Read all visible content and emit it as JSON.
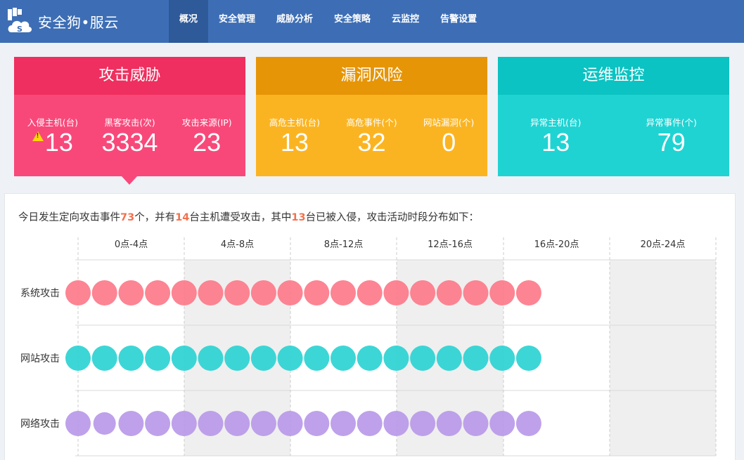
{
  "app": {
    "title": "安全狗•服云"
  },
  "nav": {
    "items": [
      {
        "label": "概况",
        "active": true
      },
      {
        "label": "安全管理"
      },
      {
        "label": "威胁分析"
      },
      {
        "label": "安全策略"
      },
      {
        "label": "云监控"
      },
      {
        "label": "告警设置"
      }
    ]
  },
  "cards": {
    "attack": {
      "title": "攻击威胁",
      "stats": [
        {
          "label": "入侵主机(台)",
          "value": "13",
          "warn": true
        },
        {
          "label": "黑客攻击(次)",
          "value": "3334"
        },
        {
          "label": "攻击来源(IP)",
          "value": "23"
        }
      ]
    },
    "vuln": {
      "title": "漏洞风险",
      "stats": [
        {
          "label": "高危主机(台)",
          "value": "13"
        },
        {
          "label": "高危事件(个)",
          "value": "32"
        },
        {
          "label": "网站漏洞(个)",
          "value": "0"
        }
      ]
    },
    "ops": {
      "title": "运维监控",
      "stats": [
        {
          "label": "异常主机(台)",
          "value": "13"
        },
        {
          "label": "异常事件(个)",
          "value": "79"
        }
      ]
    }
  },
  "summary": {
    "p1": "今日发生定向攻击事件",
    "n1": "73",
    "p2": "个，并有",
    "n2": "14",
    "p3": "台主机遭受攻击，其中",
    "n3": "13",
    "p4": "台已被入侵，攻击活动时段分布如下："
  },
  "chart_data": {
    "type": "scatter",
    "categories": [
      "0点-4点",
      "4点-8点",
      "8点-12点",
      "12点-16点",
      "16点-20点",
      "20点-24点"
    ],
    "series": [
      {
        "name": "系统攻击",
        "color": "#fd7a8a",
        "count": 18,
        "small_index": []
      },
      {
        "name": "网站攻击",
        "color": "#2dd2d2",
        "count": 18,
        "small_index": []
      },
      {
        "name": "网络攻击",
        "color": "#b999e8",
        "count": 18,
        "small_index": [
          1
        ]
      }
    ]
  }
}
